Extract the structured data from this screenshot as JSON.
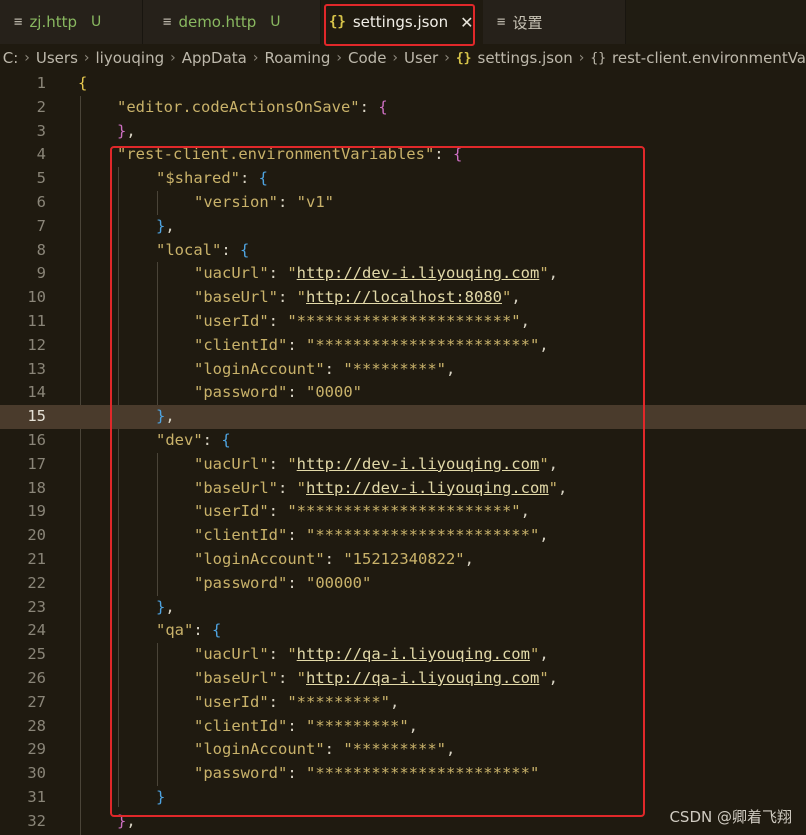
{
  "tabs": [
    {
      "icon": "≡",
      "label": "zj.http",
      "badge": "U",
      "active": false,
      "modified": true
    },
    {
      "icon": "≡",
      "label": "demo.http",
      "badge": "U",
      "active": false,
      "modified": true
    },
    {
      "icon": "{}",
      "label": "settings.json",
      "close": "✕",
      "active": true
    },
    {
      "icon": "≡",
      "label": "设置",
      "active": false
    }
  ],
  "breadcrumb": {
    "segments": [
      "C:",
      "Users",
      "liyouqing",
      "AppData",
      "Roaming",
      "Code",
      "User"
    ],
    "file_icon": "{}",
    "file": "settings.json",
    "symbol_icon": "{}",
    "symbol": "rest-client.environmentVa"
  },
  "editor": {
    "current_line": 15,
    "lines": [
      {
        "n": "1"
      },
      {
        "n": "2"
      },
      {
        "n": "3"
      },
      {
        "n": "4"
      },
      {
        "n": "5"
      },
      {
        "n": "6"
      },
      {
        "n": "7"
      },
      {
        "n": "8"
      },
      {
        "n": "9"
      },
      {
        "n": "10"
      },
      {
        "n": "11"
      },
      {
        "n": "12"
      },
      {
        "n": "13"
      },
      {
        "n": "14"
      },
      {
        "n": "15"
      },
      {
        "n": "16"
      },
      {
        "n": "17"
      },
      {
        "n": "18"
      },
      {
        "n": "19"
      },
      {
        "n": "20"
      },
      {
        "n": "21"
      },
      {
        "n": "22"
      },
      {
        "n": "23"
      },
      {
        "n": "24"
      },
      {
        "n": "25"
      },
      {
        "n": "26"
      },
      {
        "n": "27"
      },
      {
        "n": "28"
      },
      {
        "n": "29"
      },
      {
        "n": "30"
      },
      {
        "n": "31"
      },
      {
        "n": "32"
      }
    ],
    "keys": {
      "code_actions": "\"editor.codeActionsOnSave\"",
      "env_vars": "\"rest-client.environmentVariables\"",
      "shared": "\"$shared\"",
      "version": "\"version\"",
      "local": "\"local\"",
      "uac_url": "\"uacUrl\"",
      "base_url": "\"baseUrl\"",
      "user_id": "\"userId\"",
      "client_id": "\"clientId\"",
      "login_account": "\"loginAccount\"",
      "password": "\"password\"",
      "dev": "\"dev\"",
      "qa": "\"qa\""
    },
    "values": {
      "version": "\"v1\"",
      "local_uac": "http://dev-i.liyouqing.com",
      "local_base": "http://localhost:8080",
      "local_user_id": "\"***********************\"",
      "local_client_id": "\"***********************\"",
      "local_login": "\"*********\"",
      "local_password": "\"0000\"",
      "dev_uac": "http://dev-i.liyouqing.com",
      "dev_base": "http://dev-i.liyouqing.com",
      "dev_user_id": "\"***********************\"",
      "dev_client_id": "\"***********************\"",
      "dev_login": "\"15212340822\"",
      "dev_password": "\"00000\"",
      "qa_uac": "http://qa-i.liyouqing.com",
      "qa_base": "http://qa-i.liyouqing.com",
      "qa_user_id": "\"*********\"",
      "qa_client_id": "\"*********\"",
      "qa_login": "\"*********\"",
      "qa_password": "\"***********************\""
    }
  },
  "watermark": "CSDN @卿着飞翔",
  "colors": {
    "background": "#1f1a10",
    "highlight_box": "#e0282a",
    "string": "#c9b26a",
    "current_line": "#4a3b2c"
  }
}
